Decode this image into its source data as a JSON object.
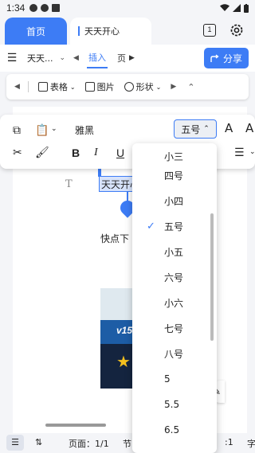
{
  "status_bar": {
    "time": "1:34"
  },
  "tabs": {
    "home": "首页",
    "document": "天天开心",
    "window_count": "1"
  },
  "toolbar": {
    "doc_name": "天天...",
    "insert_tab": "插入",
    "page_tab": "页",
    "share_label": "分享"
  },
  "ribbon": {
    "table_label": "表格",
    "picture_label": "图片",
    "shape_label": "形状"
  },
  "format_bar": {
    "font_name": "雅黑",
    "font_size": "五号",
    "grow_label": "A",
    "shrink_label": "A"
  },
  "font_size_menu": {
    "items": [
      "小三",
      "四号",
      "小四",
      "五号",
      "小五",
      "六号",
      "小六",
      "七号",
      "八号",
      "5",
      "5.5",
      "6.5"
    ],
    "selected": "五号"
  },
  "document": {
    "selected_text": "天天开心",
    "body_text": "快点下",
    "picture_label": "v15"
  },
  "bottom_bar": {
    "page_info": "页面：1/1",
    "section_label": "节",
    "right_info": ":1",
    "right_label": "字"
  }
}
